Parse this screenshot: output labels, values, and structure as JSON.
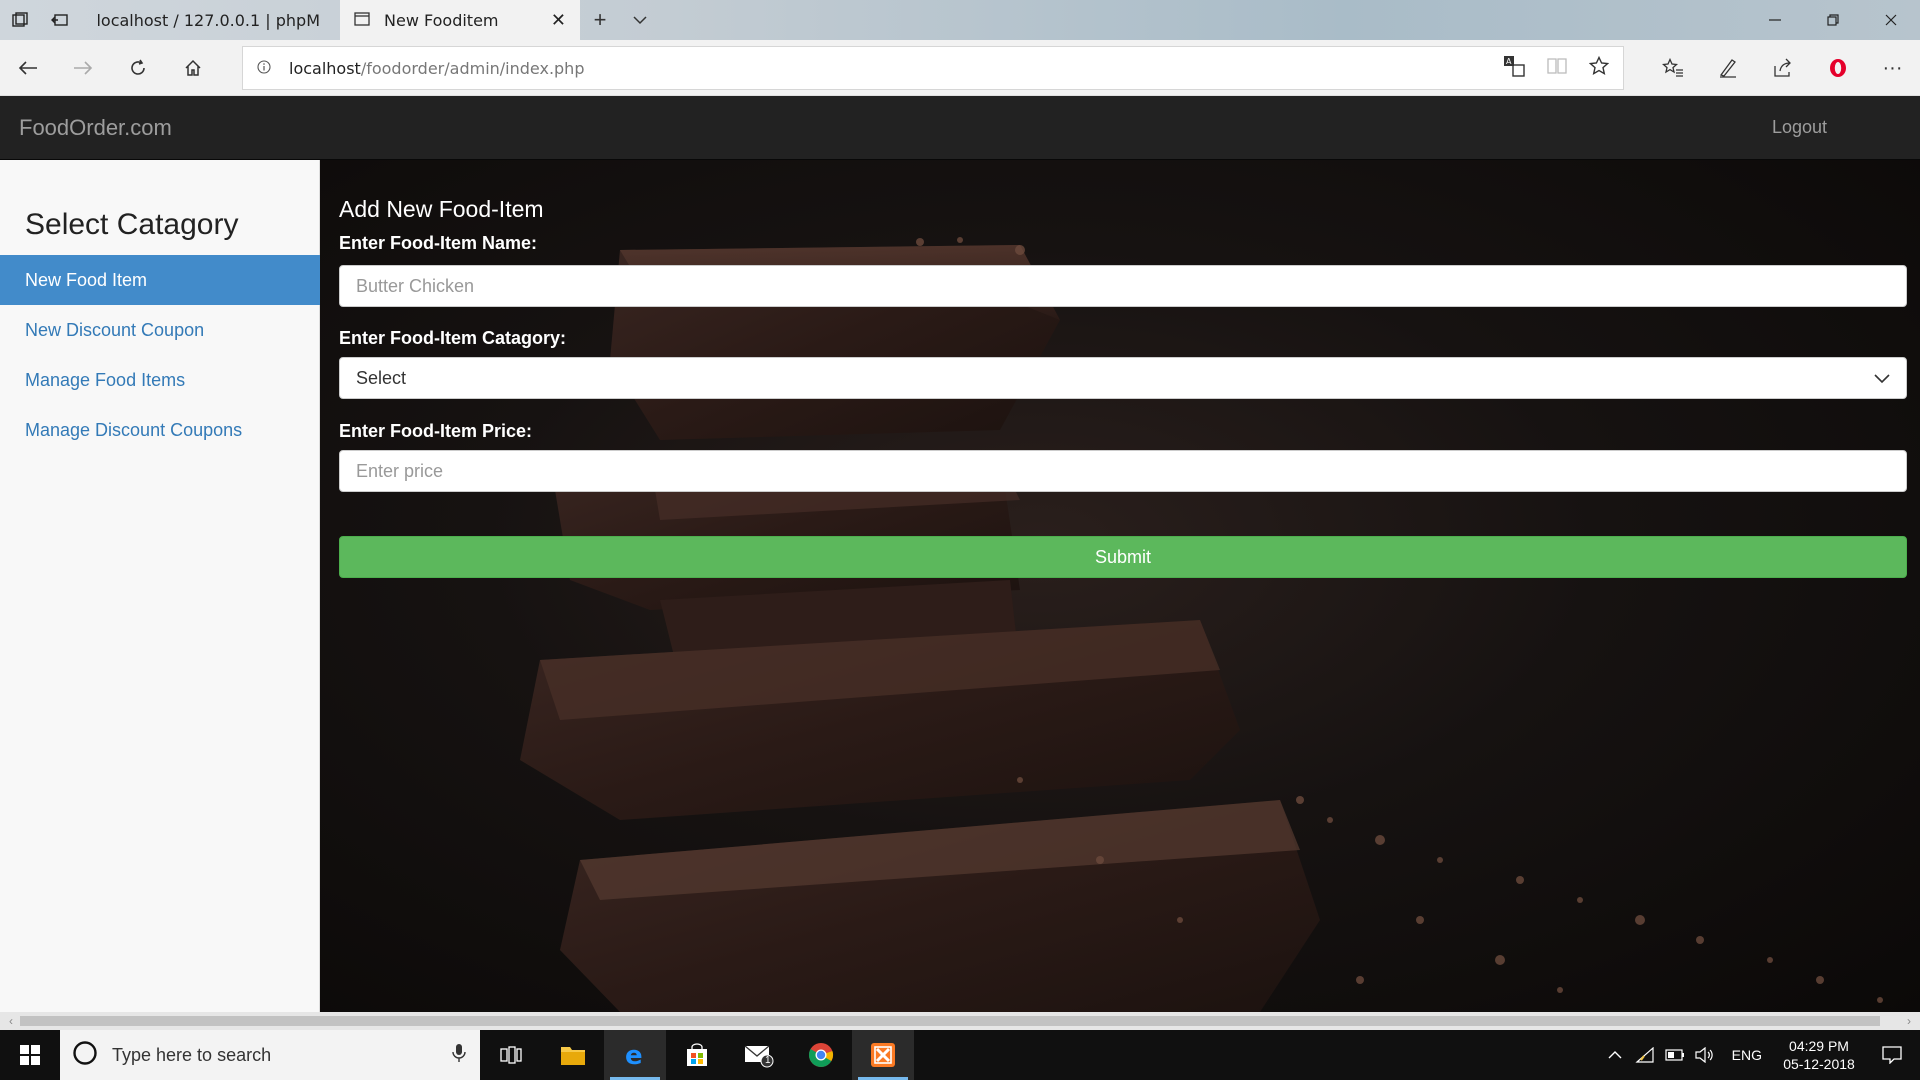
{
  "browser": {
    "tabs": [
      {
        "label": "localhost / 127.0.0.1 | phpM"
      },
      {
        "label": "New Fooditem"
      }
    ],
    "url_host": "localhost",
    "url_path": "/foodorder/admin/index.php"
  },
  "navbar": {
    "brand": "FoodOrder.com",
    "logout": "Logout"
  },
  "sidebar": {
    "title": "Select Catagory",
    "items": [
      {
        "label": "New Food Item",
        "active": true
      },
      {
        "label": "New Discount Coupon"
      },
      {
        "label": "Manage Food Items"
      },
      {
        "label": "Manage Discount Coupons"
      }
    ]
  },
  "form": {
    "title": "Add New Food-Item",
    "name_label": "Enter Food-Item Name:",
    "name_placeholder": "Butter Chicken",
    "category_label": "Enter Food-Item Catagory:",
    "category_value": "Select",
    "price_label": "Enter Food-Item Price:",
    "price_placeholder": "Enter price",
    "submit_label": "Submit"
  },
  "taskbar": {
    "search_placeholder": "Type here to search",
    "mail_badge": "1",
    "lang": "ENG",
    "time": "04:29 PM",
    "date": "05-12-2018"
  },
  "colors": {
    "navbar_bg": "#222222",
    "sidebar_active": "#428bca",
    "link": "#337ab7",
    "submit": "#5cb85c"
  }
}
